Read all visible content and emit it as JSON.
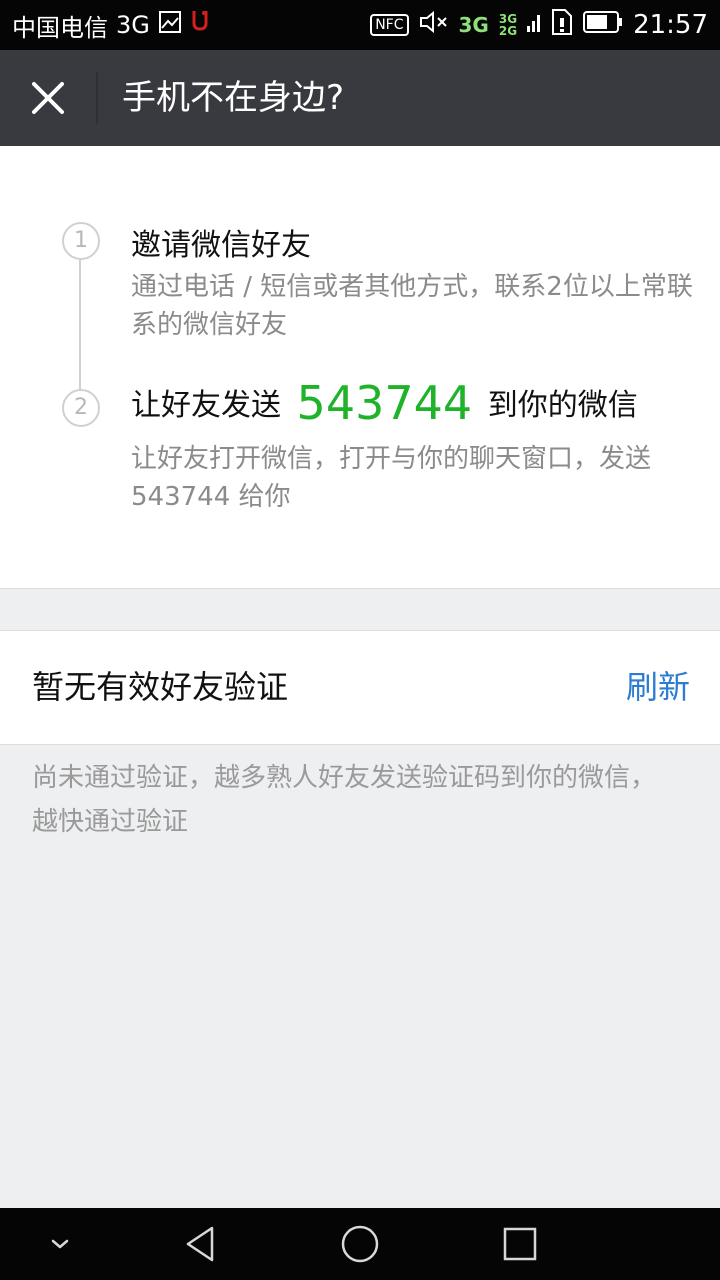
{
  "status_bar": {
    "carrier": "中国电信",
    "network": "3G",
    "nfc_label": "NFC",
    "network_primary": "3G",
    "network_secondary_top": "3G",
    "network_secondary_bottom": "2G",
    "time": "21:57"
  },
  "header": {
    "title": "手机不在身边?",
    "close_icon": "close-icon"
  },
  "steps": [
    {
      "number": "1",
      "title": "邀请微信好友",
      "description": "通过电话 / 短信或者其他方式，联系2位以上常联系的微信好友"
    },
    {
      "number": "2",
      "title_prefix": "让好友发送",
      "code": "543744",
      "title_suffix": "到你的微信",
      "description": "让好友打开微信，打开与你的聊天窗口，发送543744 给你"
    }
  ],
  "verify": {
    "status_label": "暂无有效好友验证",
    "refresh_label": "刷新"
  },
  "hint": "尚未通过验证，越多熟人好友发送验证码到你的微信，越快通过验证",
  "colors": {
    "accent_green": "#1fb32a",
    "link_blue": "#2b7cd3",
    "header_bg": "#393a3f"
  },
  "nav_icons": [
    "chevron-down-icon",
    "back-icon",
    "home-icon",
    "recents-icon"
  ]
}
